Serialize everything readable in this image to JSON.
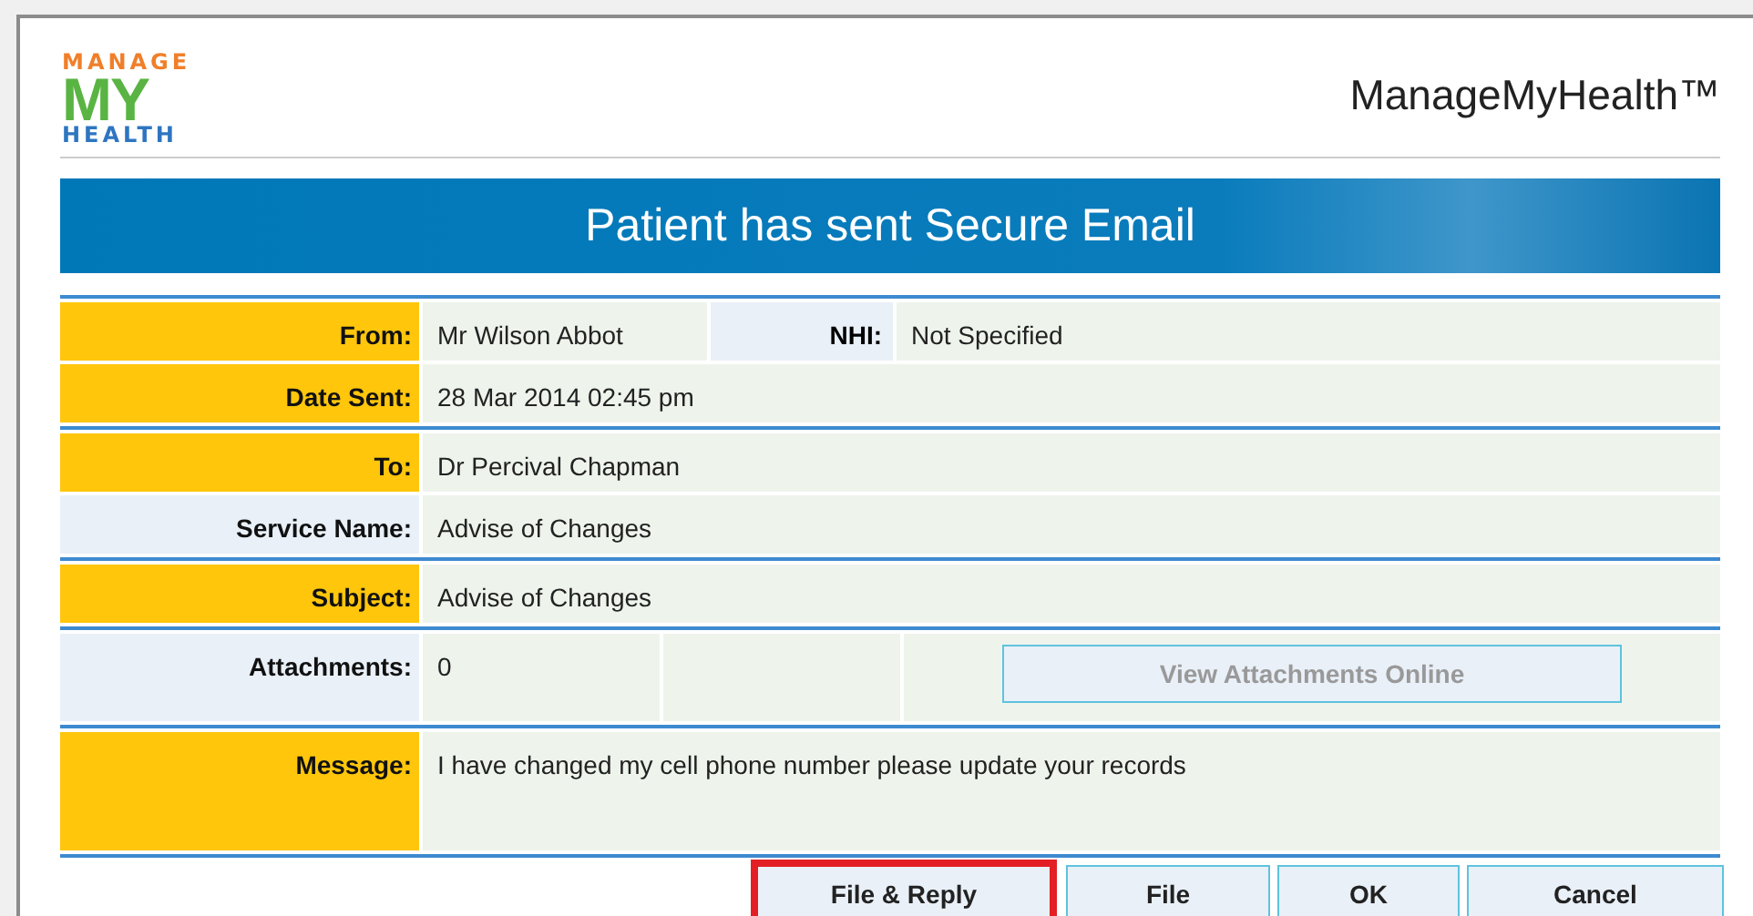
{
  "logo": {
    "top": "MANAGE",
    "middle": "MY",
    "bottom": "HEALTH"
  },
  "brand": "ManageMyHealth™",
  "banner": "Patient has sent Secure Email",
  "groups": [
    [
      {
        "label": "From:",
        "value": "Mr Wilson Abbot",
        "highlighted": true,
        "extra": {
          "kind": "field",
          "label": "NHI:",
          "value": "Not Specified"
        }
      },
      {
        "label": "Date Sent:",
        "value": "28 Mar 2014 02:45 pm",
        "highlighted": true
      }
    ],
    [
      {
        "label": "To:",
        "value": "Dr Percival Chapman",
        "highlighted": true
      },
      {
        "label": "Service Name:",
        "value": "Advise of Changes",
        "highlighted": false
      }
    ],
    [
      {
        "label": "Subject:",
        "value": "Advise of Changes",
        "highlighted": true
      }
    ],
    [
      {
        "label": "Attachments:",
        "value": "0",
        "highlighted": false,
        "tall": true,
        "extra": {
          "kind": "button",
          "label": "View Attachments Online",
          "disabled": true
        }
      }
    ],
    [
      {
        "label": "Message:",
        "value": "I have changed my cell phone number please update your records",
        "highlighted": true,
        "message": true
      }
    ]
  ],
  "buttons": [
    {
      "label": "File & Reply",
      "outlined": true
    },
    {
      "label": "File",
      "outlined": false
    },
    {
      "label": "OK",
      "outlined": false
    },
    {
      "label": "Cancel",
      "outlined": false
    }
  ]
}
